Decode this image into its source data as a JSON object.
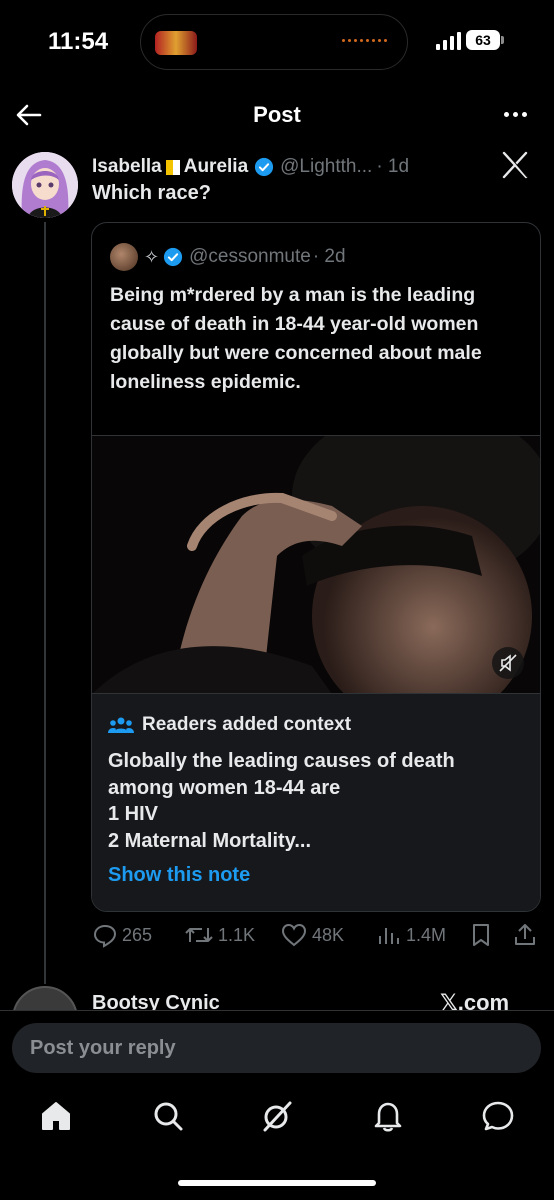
{
  "status_bar": {
    "time": "11:54",
    "battery": "63"
  },
  "header": {
    "title": "Post"
  },
  "post": {
    "author_first": "Isabella",
    "author_last": "Aurelia",
    "handle": "@Lightth...",
    "time": "· 1d",
    "text": "Which race?"
  },
  "quote": {
    "handle": "@cessonmute",
    "time": "· 2d",
    "text": "Being m*rdered by a man is the leading cause of death in 18-44 year-old women globally but were concerned about male loneliness epidemic.",
    "note": {
      "title": "Readers added context",
      "lines": [
        "Globally the leading causes of death",
        "among women 18-44 are",
        "1 HIV",
        "2 Maternal Mortality..."
      ],
      "link": "Show this note"
    }
  },
  "actions": {
    "replies": "265",
    "reposts": "1.1K",
    "likes": "48K",
    "views": "1.4M"
  },
  "next_reply": {
    "name": "Bootsy Cynic",
    "link_text": "𝕏.com"
  },
  "reply_bar": {
    "placeholder": "Post your reply"
  },
  "tabbar": {
    "items": [
      "home-icon",
      "search-icon",
      "grok-icon",
      "notifications-icon",
      "messages-icon"
    ]
  },
  "colors": {
    "accent": "#1d9bf0",
    "secondary_text": "#71767b",
    "background": "#000000"
  }
}
